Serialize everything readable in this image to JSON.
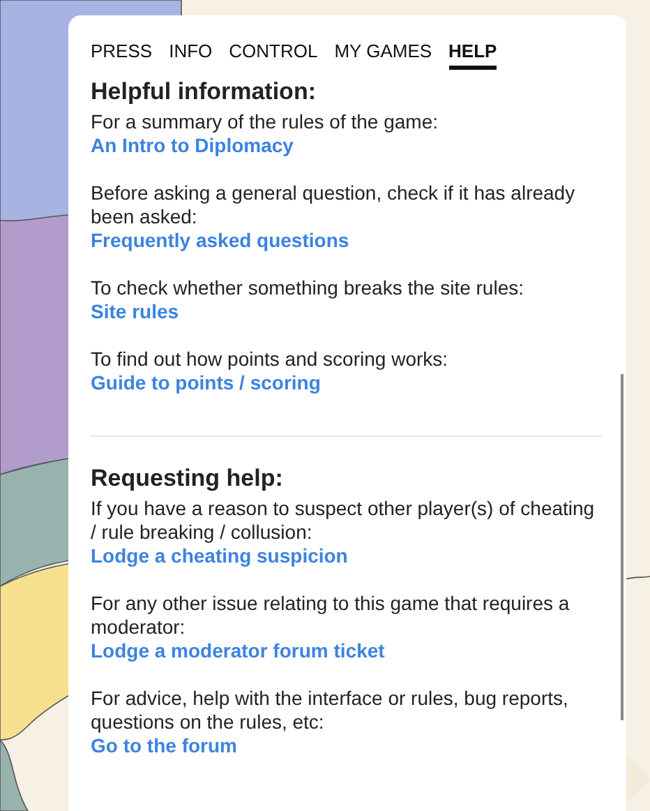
{
  "tabs": [
    {
      "label": "PRESS",
      "selected": false
    },
    {
      "label": "INFO",
      "selected": false
    },
    {
      "label": "CONTROL",
      "selected": false
    },
    {
      "label": "MY GAMES",
      "selected": false
    },
    {
      "label": "HELP",
      "selected": true
    }
  ],
  "sections": [
    {
      "heading": "Helpful information:",
      "items": [
        {
          "text": "For a summary of the rules of the game:",
          "link": "An Intro to Diplomacy"
        },
        {
          "text": "Before asking a general question, check if it has already been asked:",
          "link": "Frequently asked questions"
        },
        {
          "text": "To check whether something breaks the site rules:",
          "link": "Site rules"
        },
        {
          "text": "To find out how points and scoring works:",
          "link": "Guide to points / scoring"
        }
      ]
    },
    {
      "heading": "Requesting help:",
      "items": [
        {
          "text": "If you have a reason to suspect other player(s) of cheating / rule breaking / collusion:",
          "link": "Lodge a cheating suspicion"
        },
        {
          "text": "For any other issue relating to this game that requires a moderator:",
          "link": "Lodge a moderator forum ticket"
        },
        {
          "text": "For advice, help with the interface or rules, bug reports, questions on the rules, etc:",
          "link": "Go to the forum"
        }
      ]
    }
  ]
}
